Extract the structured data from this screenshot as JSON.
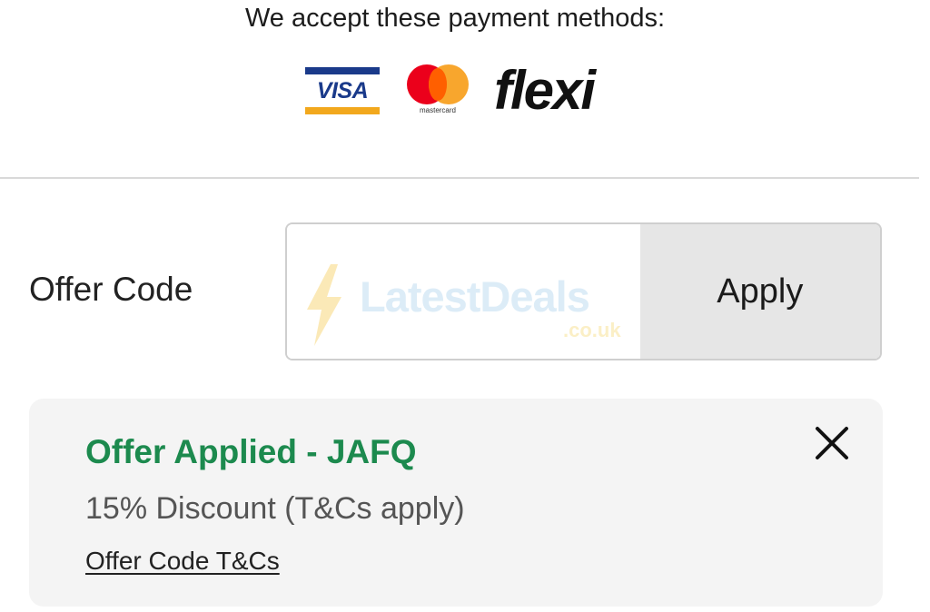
{
  "payment": {
    "title": "We accept these payment methods:",
    "methods": [
      {
        "name": "VISA",
        "icon": "visa-logo-icon",
        "colors": {
          "primary": "#1a3a8a",
          "accent": "#f2a81d"
        }
      },
      {
        "name": "mastercard",
        "icon": "mastercard-logo-icon",
        "colors": {
          "left": "#eb001b",
          "right": "#f79e1b"
        }
      },
      {
        "name": "flexi",
        "icon": "flexi-logo-icon",
        "colors": {
          "primary": "#111111"
        }
      }
    ]
  },
  "offer": {
    "label": "Offer Code",
    "input_value": "",
    "input_placeholder": "",
    "apply_label": "Apply",
    "watermark": {
      "main": "LatestDeals",
      "sub": ".co.uk"
    }
  },
  "applied": {
    "title": "Offer Applied - JAFQ",
    "discount": "15% Discount (T&Cs apply)",
    "tcs_link": "Offer Code T&Cs",
    "close_icon": "close-icon",
    "accent_color": "#1c8a4e"
  }
}
